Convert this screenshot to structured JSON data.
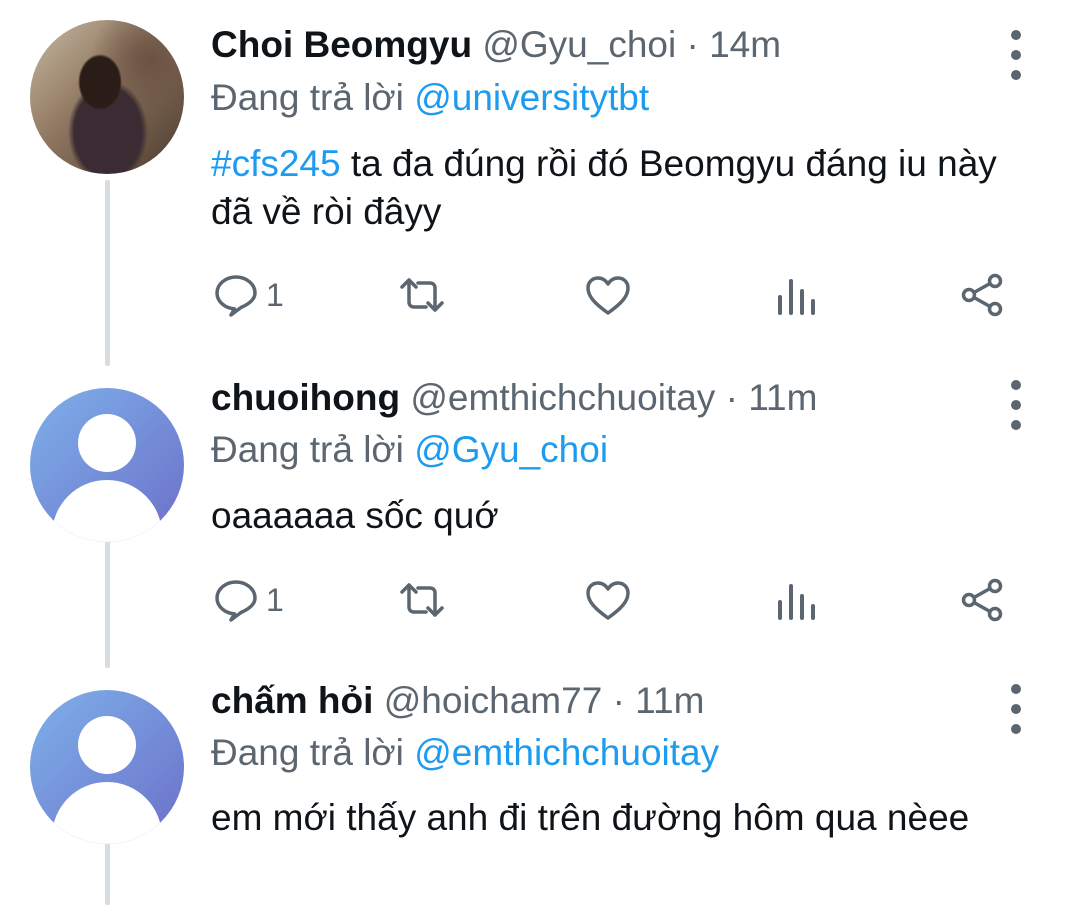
{
  "colors": {
    "link": "#1d9bf0",
    "secondary": "#5b6670",
    "primary": "#0f1419"
  },
  "tweets": [
    {
      "name": "Choi Beomgyu",
      "handle": "@Gyu_choi",
      "separator": "·",
      "time": "14m",
      "reply_prefix": "Đang trả lời",
      "reply_to": "@universitytbt",
      "hashtag": "#cfs245",
      "text": " ta đa đúng rồi đó Beomgyu đáng iu này đã về ròi đâyy",
      "reply_count": "1",
      "avatar": "profile-photo"
    },
    {
      "name": "chuoihong",
      "handle": "@emthichchuoitay",
      "separator": "·",
      "time": "11m",
      "reply_prefix": "Đang trả lời",
      "reply_to": "@Gyu_choi",
      "text": "oaaaaaa sốc quớ",
      "reply_count": "1",
      "avatar": "default-avatar"
    },
    {
      "name": "chấm hỏi",
      "handle": "@hoicham77",
      "separator": "·",
      "time": "11m",
      "reply_prefix": "Đang trả lời",
      "reply_to": "@emthichchuoitay",
      "text": "em mới thấy anh đi trên đường hôm qua nèee",
      "avatar": "default-avatar"
    }
  ],
  "icons": [
    "reply-icon",
    "retweet-icon",
    "like-icon",
    "analytics-icon",
    "share-icon",
    "more-icon"
  ]
}
